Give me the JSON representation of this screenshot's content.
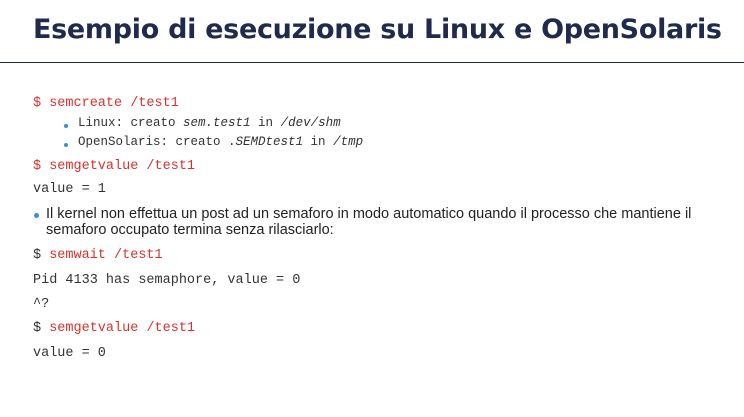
{
  "slide": {
    "title": "Esempio di esecuzione su Linux e OpenSolaris"
  },
  "commands": {
    "prompt": "$ ",
    "cmd1": "semcreate /test1",
    "cmd2": "semgetvalue /test1",
    "cmd3": "semwait /test1",
    "cmd4": "semgetvalue /test1"
  },
  "notes": {
    "linux_prefix": "Linux: creato ",
    "linux_file": "sem.test1",
    "linux_in": " in ",
    "linux_dir": "/dev/shm",
    "solaris_prefix": "OpenSolaris: creato .",
    "solaris_file": "SEMDtest1",
    "solaris_in": " in ",
    "solaris_dir": "/tmp"
  },
  "outputs": {
    "value1": "value = 1",
    "pid_line": "Pid 4133 has semaphore, value = 0",
    "interrupt": "^?",
    "value0": "value = 0"
  },
  "bullet_text": "Il kernel non effettua un post ad un semaforo in modo automatico quando il processo che mantiene il semaforo occupato termina senza rilasciarlo:",
  "colors": {
    "title": "#1f2a4d",
    "command": "#d9322d",
    "bullet": "#3a8fd6"
  }
}
